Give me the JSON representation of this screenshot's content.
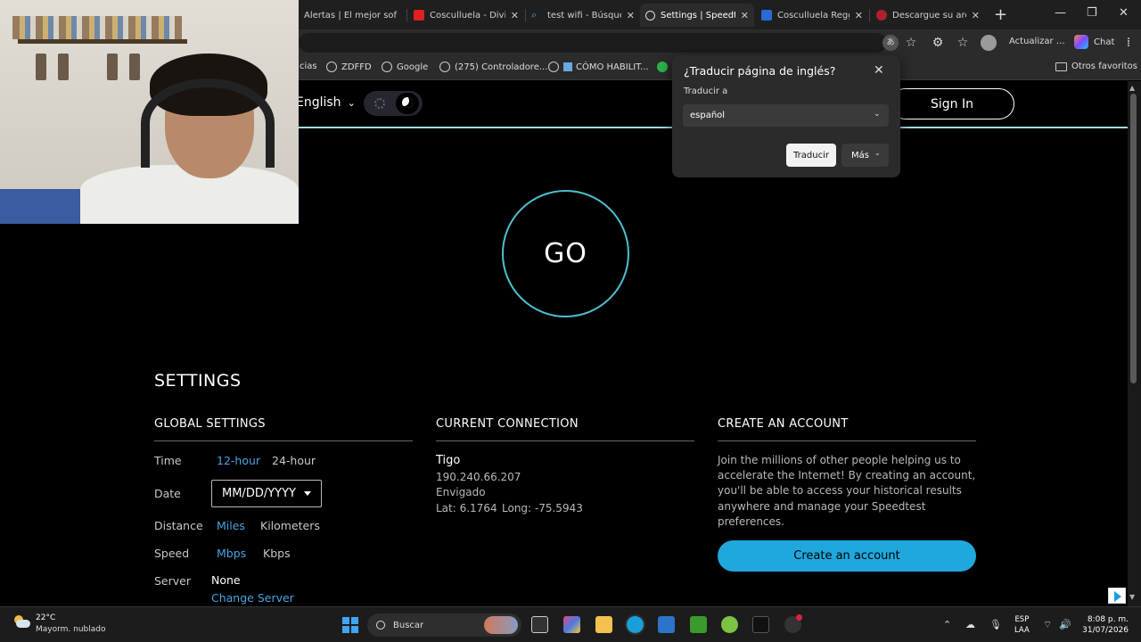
{
  "browser": {
    "tabs": [
      {
        "title": "Alertas | El mejor sof",
        "active": false
      },
      {
        "title": "Cosculluela - Dividi",
        "active": false
      },
      {
        "title": "test wifi - Búsqueda",
        "active": false
      },
      {
        "title": "Settings | Speedtest",
        "active": true
      },
      {
        "title": "Cosculluela Reggae",
        "active": false
      },
      {
        "title": "Descargue su archiv",
        "active": false
      }
    ],
    "update_label": "Actualizar",
    "more_label": "…",
    "chat_label": "Chat",
    "bookmarks": [
      {
        "label": "cias"
      },
      {
        "label": "ZDFFD"
      },
      {
        "label": "Google"
      },
      {
        "label": "(275) Controladore..."
      },
      {
        "label": "CÓMO HABILIT..."
      }
    ],
    "other_favorites": "Otros favoritos"
  },
  "translate_popup": {
    "title": "¿Traducir página de inglés?",
    "subtitle": "Traducir a",
    "selected_language": "español",
    "translate_button": "Traducir",
    "more_button": "Más"
  },
  "header": {
    "language": "English",
    "sign_in": "Sign In"
  },
  "go_button": "GO",
  "settings": {
    "title": "SETTINGS",
    "global": {
      "heading": "GLOBAL SETTINGS",
      "time_label": "Time",
      "time_options": [
        "12-hour",
        "24-hour"
      ],
      "date_label": "Date",
      "date_value": "MM/DD/YYYY",
      "distance_label": "Distance",
      "distance_options": [
        "Miles",
        "Kilometers"
      ],
      "speed_label": "Speed",
      "speed_options": [
        "Mbps",
        "Kbps"
      ],
      "server_label": "Server",
      "server_value": "None",
      "change_server": "Change Server"
    },
    "connection": {
      "heading": "CURRENT CONNECTION",
      "isp": "Tigo",
      "ip": "190.240.66.207",
      "city": "Envigado",
      "lat": "Lat: 6.1764",
      "long": "Long: -75.5943"
    },
    "account": {
      "heading": "CREATE AN ACCOUNT",
      "text": "Join the millions of other people helping us to accelerate the Internet! By creating an account, you'll be able to access your historical results anywhere and manage your Speedtest preferences.",
      "button": "Create an account"
    }
  },
  "taskbar": {
    "temperature": "22°C",
    "weather": "Mayorm. nublado",
    "search_placeholder": "Buscar",
    "lang_line1": "ESP",
    "lang_line2": "LAA",
    "time": "8:08 p. m.",
    "date": "31/07/2026"
  },
  "colors": {
    "accent_blue": "#4aa3df",
    "button_cyan": "#1fa8dc",
    "go_ring": "#4fc0d0"
  }
}
